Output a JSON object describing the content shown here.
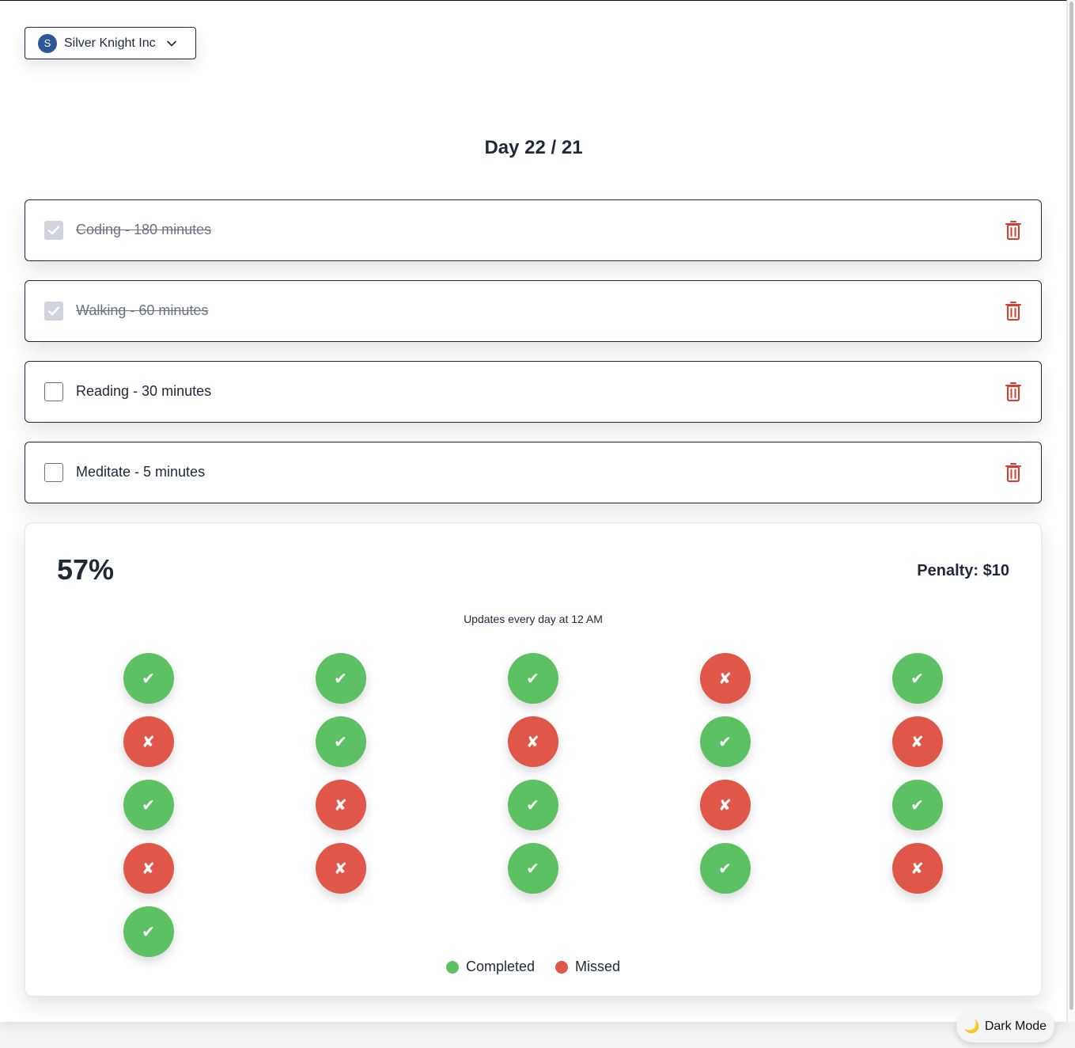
{
  "org_switcher": {
    "avatar_letter": "S",
    "name": "Silver Knight Inc",
    "icon": "chevron-down-icon"
  },
  "header": {
    "title": "Day 22 / 21"
  },
  "tasks": [
    {
      "label": "Coding - 180 minutes",
      "done": true
    },
    {
      "label": "Walking - 60 minutes",
      "done": true
    },
    {
      "label": "Reading - 30 minutes",
      "done": false
    },
    {
      "label": "Meditate - 5 minutes",
      "done": false
    }
  ],
  "stats": {
    "percent": "57%",
    "penalty": "Penalty: $10",
    "update_note": "Updates every day at 12 AM",
    "days": [
      "completed",
      "completed",
      "completed",
      "missed",
      "completed",
      "missed",
      "completed",
      "missed",
      "completed",
      "missed",
      "completed",
      "missed",
      "completed",
      "missed",
      "completed",
      "missed",
      "missed",
      "completed",
      "completed",
      "missed",
      "completed"
    ],
    "legend": {
      "completed": "Completed",
      "missed": "Missed"
    }
  },
  "colors": {
    "completed": "#5cc162",
    "missed": "#e0574a",
    "trash": "#dc3b2e",
    "avatar": "#2b5797"
  },
  "dark_mode": {
    "icon": "moon-icon",
    "emoji": "🌙",
    "label": "Dark Mode"
  }
}
